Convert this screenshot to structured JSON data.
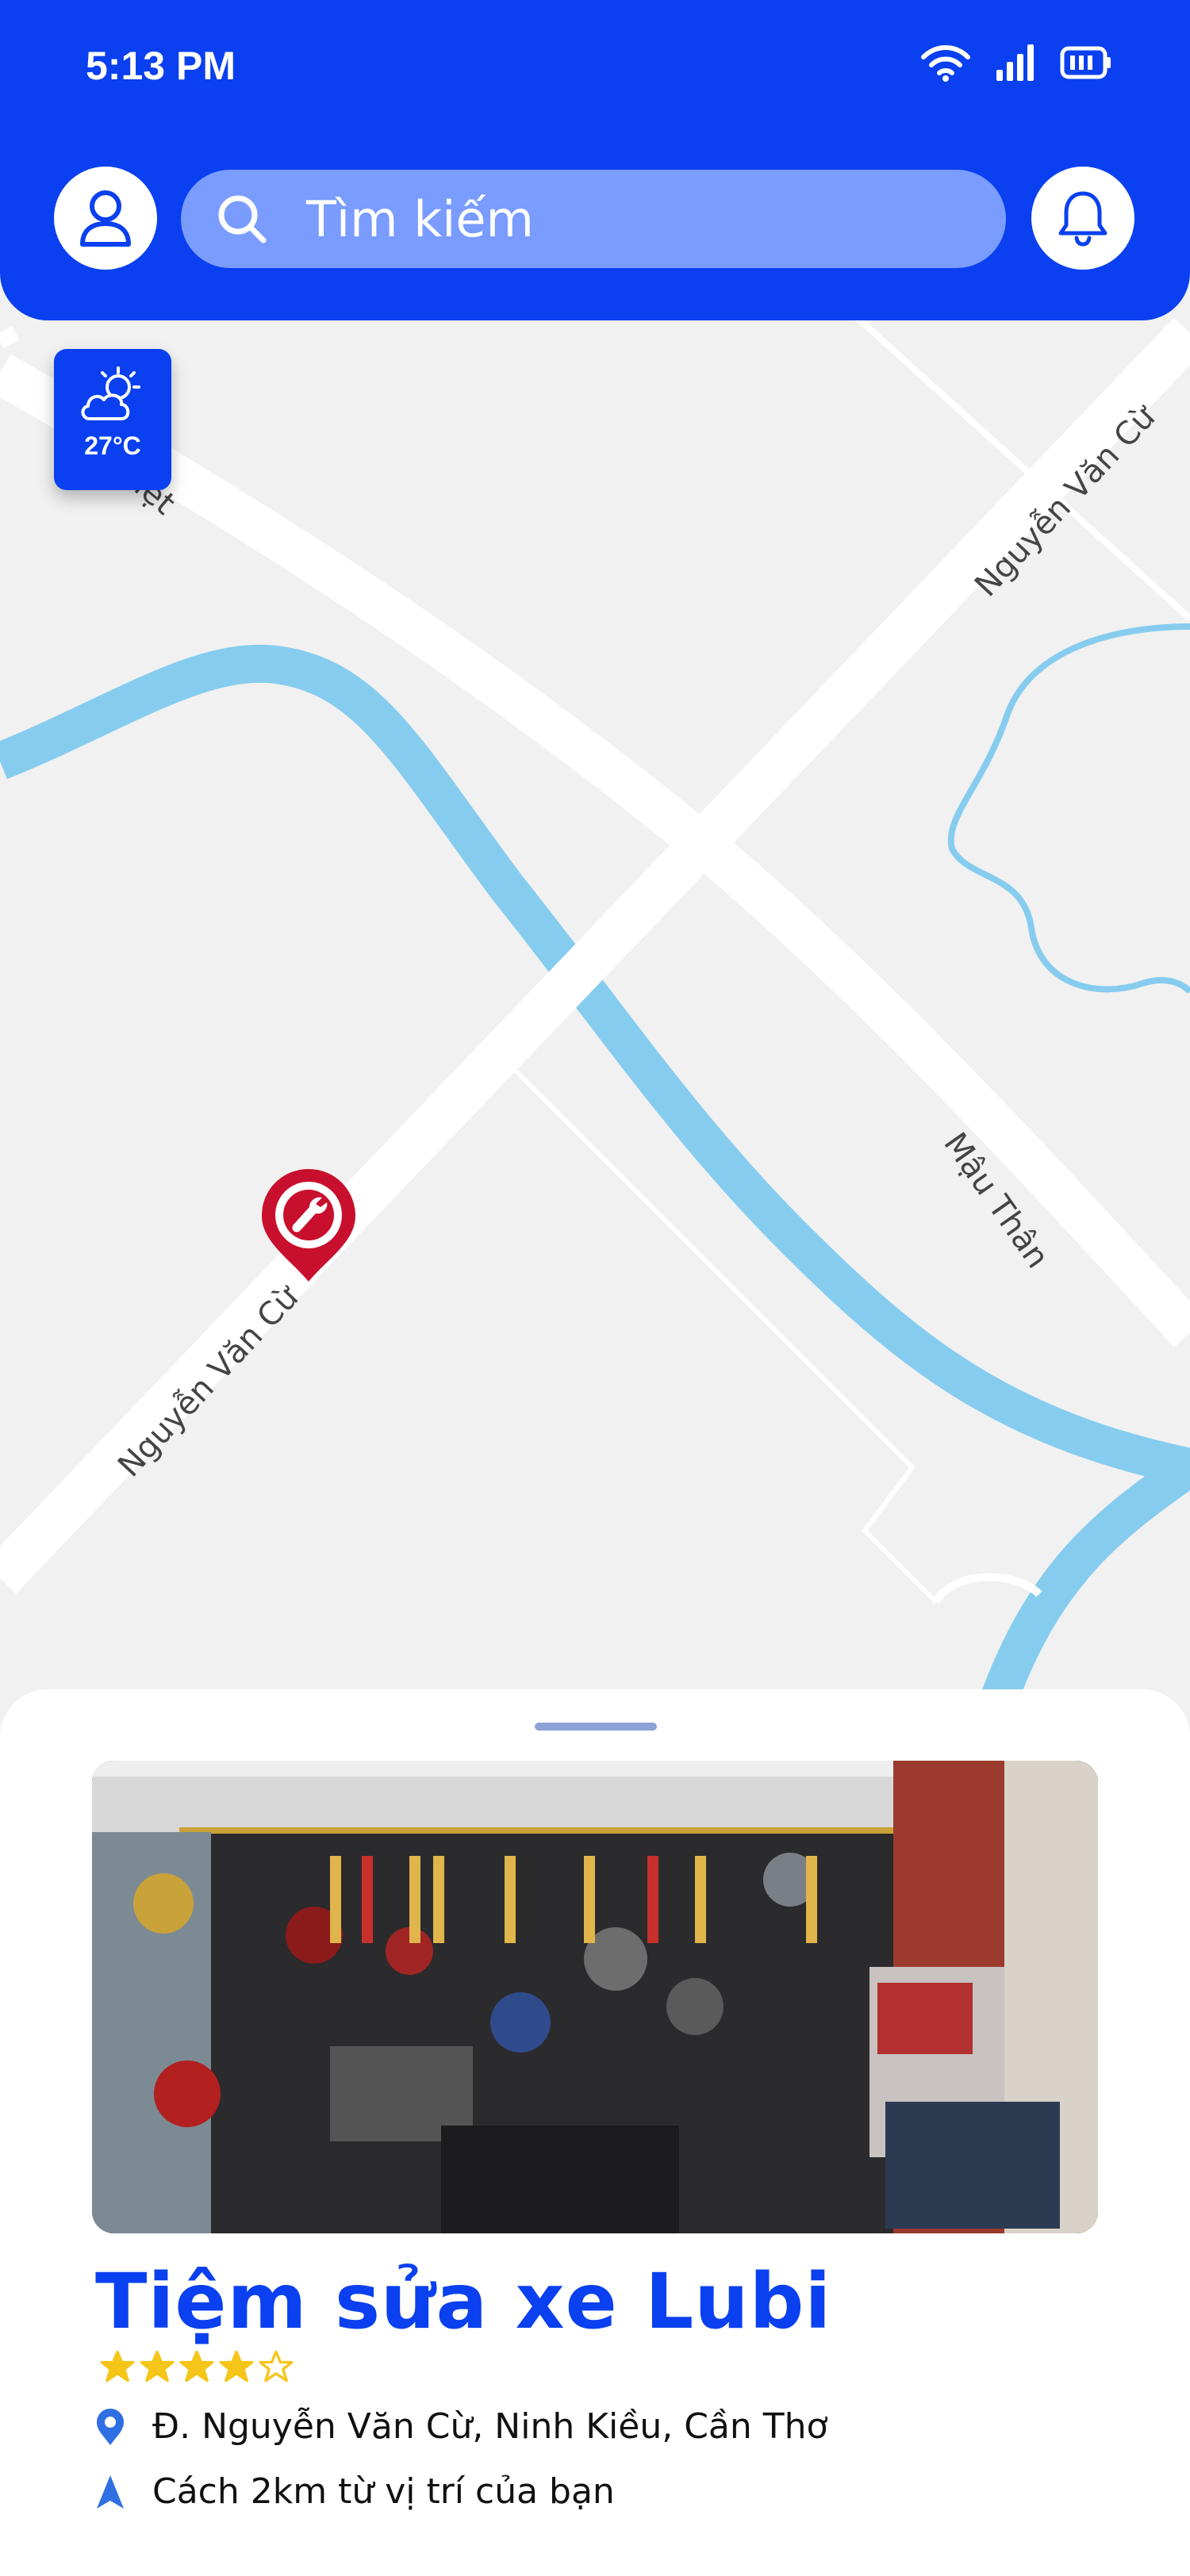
{
  "status_bar": {
    "time": "5:13 PM"
  },
  "search": {
    "placeholder": "Tìm kiếm"
  },
  "weather": {
    "temperature": "27°C",
    "icon": "partly-cloudy-icon"
  },
  "map": {
    "roads": [
      "Nguyễn Văn Cừ",
      "Nguyễn Văn Cừ",
      "Mậu Thân",
      "iệt"
    ],
    "marker_icon": "wrench-icon",
    "colors": {
      "water": "#86ccef",
      "road": "#ffffff",
      "land": "#f1f1f1",
      "marker": "#c8102e"
    }
  },
  "place": {
    "name": "Tiệm sửa xe Lubi",
    "rating": 4,
    "rating_max": 5,
    "address": "Đ. Nguyễn Văn Cừ, Ninh Kiều, Cần Thơ",
    "distance": "Cách 2km từ vị trí của bạn"
  },
  "colors": {
    "primary": "#0a40ef",
    "star": "#f5c518"
  }
}
